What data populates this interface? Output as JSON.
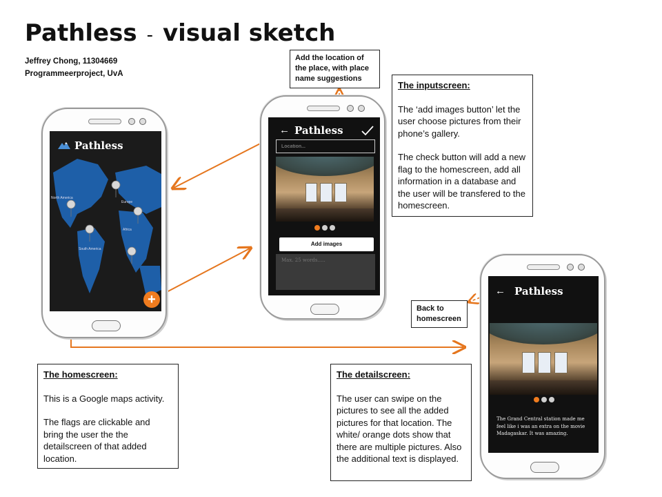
{
  "header": {
    "title": "Pathless",
    "separator": "-",
    "subtitle": "visual sketch",
    "author_line1": "Jeffrey Chong, 11304669",
    "author_line2": "Programmeerproject, UvA"
  },
  "colors": {
    "accent": "#f07c1f",
    "map_blue": "#1e5fa8",
    "screen_bg": "#111111"
  },
  "home_screen": {
    "app_name": "Pathless",
    "continents": [
      "North America",
      "Europe",
      "Africa",
      "South America"
    ],
    "add_icon": "plus-icon"
  },
  "input_screen": {
    "app_name": "Pathless",
    "back_icon": "arrow-left-icon",
    "check_icon": "check-icon",
    "location_placeholder": "Location...",
    "add_images_label": "Add images",
    "text_placeholder": "Max. 25 words....."
  },
  "detail_screen": {
    "app_name": "Pathless",
    "back_icon": "arrow-left-icon",
    "description": "The Grand Central station made me feel like i was an extra on the movie Madagaskar. It was amazing."
  },
  "notes": {
    "location": "Add the location of the place, with place name suggestions",
    "back": "Back to homescreen",
    "input": {
      "heading": "The inputscreen:",
      "p1": "The ‘add images button’ let the user choose pictures from their phone’s gallery.",
      "p2": "The check button will add a new flag to the homescreen, add all information in a database and the user will be transfered to the homescreen."
    },
    "home": {
      "heading": "The homescreen:",
      "p1": "This is a Google maps activity.",
      "p2": "The flags are clickable and bring the user the the detailscreen of that added location."
    },
    "detail": {
      "heading": "The detailscreen:",
      "p1": "The user can swipe on the pictures to see all the added pictures for that location. The white/ orange dots show that there are multiple pictures. Also the additional text is displayed."
    }
  }
}
